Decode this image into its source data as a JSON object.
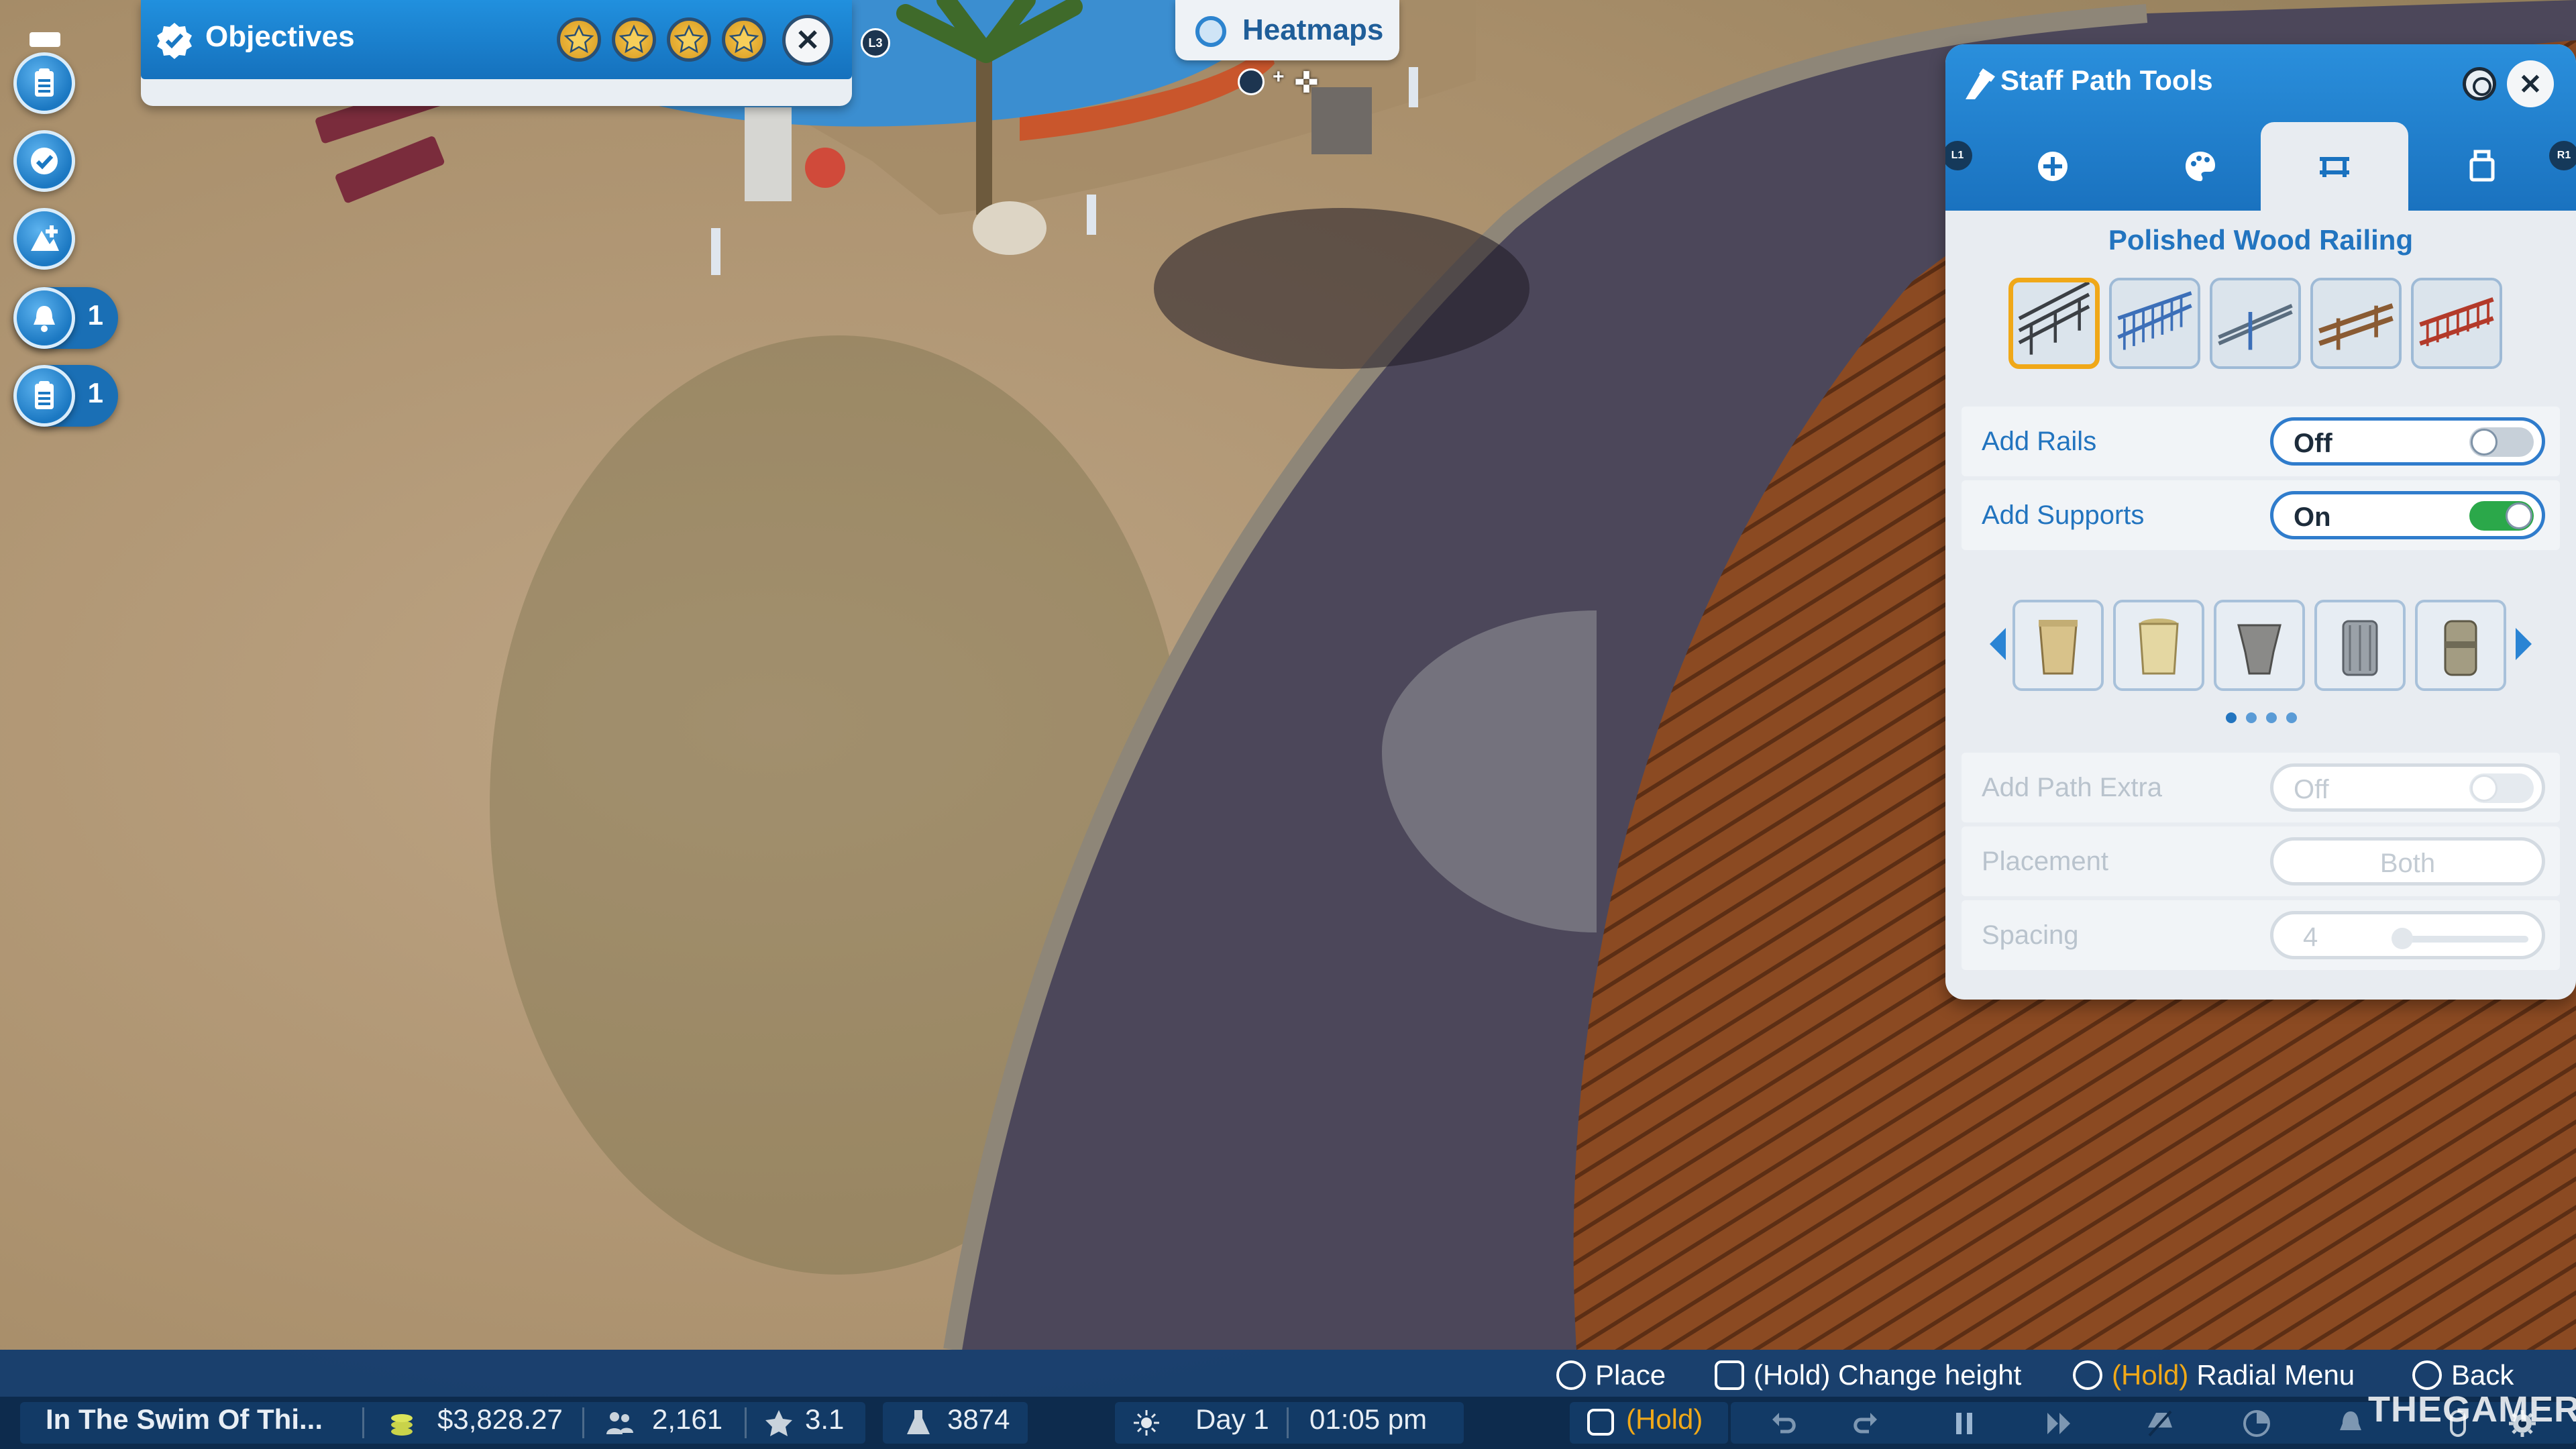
{
  "objectives": {
    "title": "Objectives",
    "stars": 4,
    "l3_badge": "L3"
  },
  "sidebar": {
    "items": [
      {
        "icon": "clipboard-icon"
      },
      {
        "icon": "checkmark-icon"
      },
      {
        "icon": "terrain-add-icon"
      },
      {
        "icon": "bell-icon",
        "count": "1"
      },
      {
        "icon": "clipboard-list-icon",
        "count": "1"
      }
    ]
  },
  "heatmaps": {
    "label": "Heatmaps",
    "plus": "+"
  },
  "tools": {
    "title": "Staff Path Tools",
    "close": "✕",
    "tabs": [
      {
        "icon": "plus-circle-icon"
      },
      {
        "icon": "palette-icon"
      },
      {
        "icon": "railing-icon",
        "active": true
      },
      {
        "icon": "path-extra-icon"
      }
    ],
    "bumper_left": "L1",
    "bumper_right": "R1",
    "railing_title": "Polished Wood Railing",
    "railings": [
      {
        "color": "#3b3f44",
        "selected": true
      },
      {
        "color": "#3c6fb8"
      },
      {
        "color": "#5a6d7f"
      },
      {
        "color": "#8a5b33"
      },
      {
        "color": "#b33a2a"
      }
    ],
    "add_rails": {
      "label": "Add Rails",
      "value": "Off"
    },
    "add_supports": {
      "label": "Add Supports",
      "value": "On"
    },
    "extras": [
      {
        "icon": "trash-bin-icon"
      },
      {
        "icon": "sand-bin-icon"
      },
      {
        "icon": "urn-bin-icon"
      },
      {
        "icon": "metal-bin-icon"
      },
      {
        "icon": "stone-bin-icon"
      }
    ],
    "page_dots": 4,
    "add_path_extra": {
      "label": "Add Path Extra",
      "value": "Off"
    },
    "placement": {
      "label": "Placement",
      "value": "Both"
    },
    "spacing": {
      "label": "Spacing",
      "value": "4"
    }
  },
  "prompts": {
    "place": "Place",
    "change_height": "(Hold) Change height",
    "radial_hold": "(Hold)",
    "radial_menu": "Radial Menu",
    "back": "Back"
  },
  "status": {
    "park_name": "In The Swim Of Thi...",
    "money": "$3,828.27",
    "guests": "2,161",
    "rating": "3.1",
    "research": "3874",
    "day": "Day 1",
    "time": "01:05 pm",
    "hold": "(Hold)"
  },
  "watermark": "THEGAMER"
}
